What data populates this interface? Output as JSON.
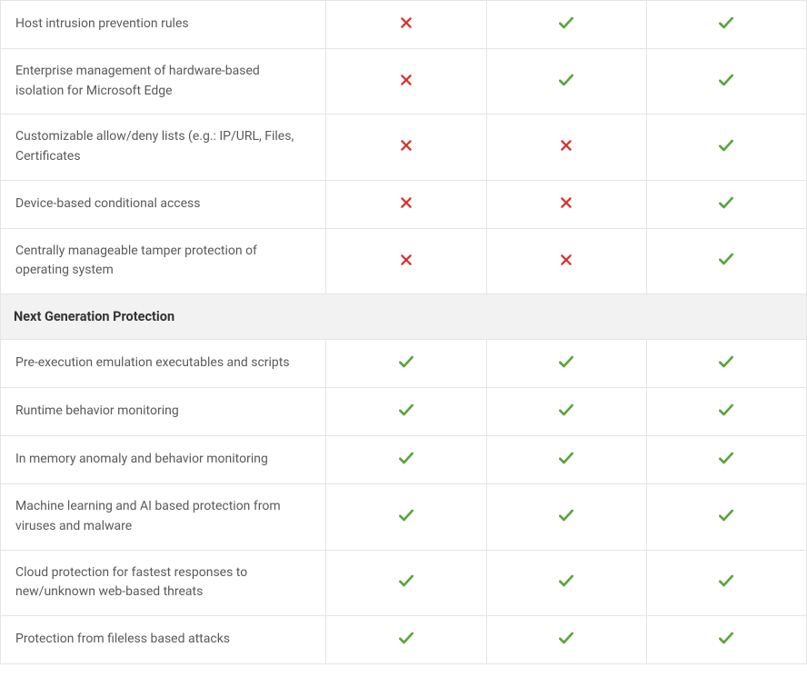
{
  "table": {
    "rows": [
      {
        "type": "feature",
        "label": "Host intrusion prevention rules",
        "values": [
          "no",
          "yes",
          "yes"
        ]
      },
      {
        "type": "feature",
        "label": "Enterprise management of hardware-based isolation for Microsoft Edge",
        "values": [
          "no",
          "yes",
          "yes"
        ]
      },
      {
        "type": "feature",
        "label": "Customizable allow/deny lists (e.g.: IP/URL, Files, Certificates",
        "values": [
          "no",
          "no",
          "yes"
        ]
      },
      {
        "type": "feature",
        "label": "Device-based conditional access",
        "values": [
          "no",
          "no",
          "yes"
        ]
      },
      {
        "type": "feature",
        "label": "Centrally manageable tamper protection of operating system",
        "values": [
          "no",
          "no",
          "yes"
        ]
      },
      {
        "type": "section",
        "label": "Next Generation Protection"
      },
      {
        "type": "feature",
        "label": "Pre-execution emulation executables and scripts",
        "values": [
          "yes",
          "yes",
          "yes"
        ]
      },
      {
        "type": "feature",
        "label": "Runtime behavior monitoring",
        "values": [
          "yes",
          "yes",
          "yes"
        ]
      },
      {
        "type": "feature",
        "label": "In memory anomaly and behavior monitoring",
        "values": [
          "yes",
          "yes",
          "yes"
        ]
      },
      {
        "type": "feature",
        "label": "Machine learning and AI based protection from viruses and malware",
        "values": [
          "yes",
          "yes",
          "yes"
        ]
      },
      {
        "type": "feature",
        "label": "Cloud protection for fastest responses to new/unknown web-based threats",
        "values": [
          "yes",
          "yes",
          "yes"
        ]
      },
      {
        "type": "feature",
        "label": "Protection from fileless based attacks",
        "values": [
          "yes",
          "yes",
          "yes"
        ]
      }
    ]
  }
}
